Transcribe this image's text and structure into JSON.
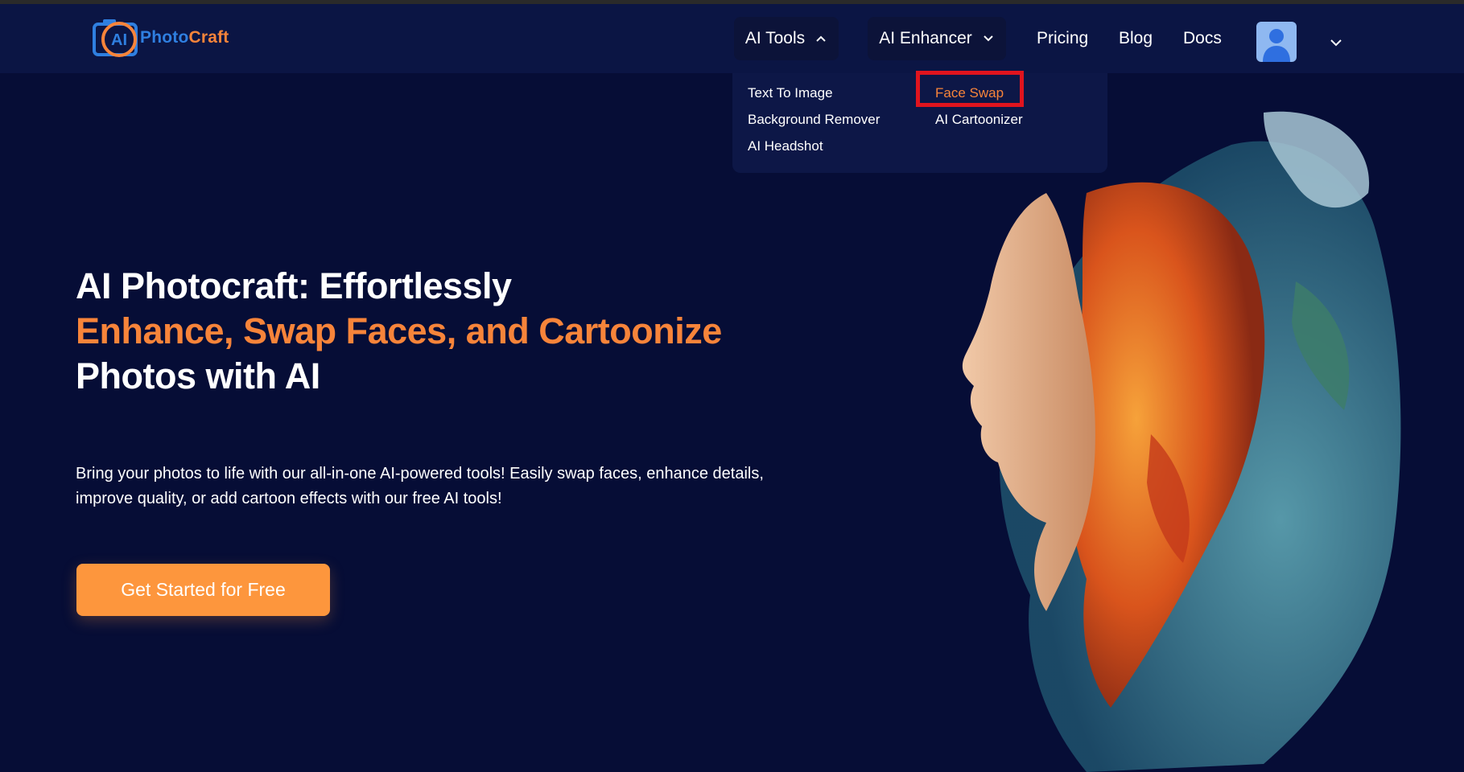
{
  "brand": {
    "name_part1": "Photo",
    "name_part2": "Craft",
    "mark_text": "AI"
  },
  "nav": {
    "ai_tools": "AI Tools",
    "ai_enhancer": "AI Enhancer",
    "pricing": "Pricing",
    "blog": "Blog",
    "docs": "Docs"
  },
  "dropdown": {
    "left_items": [
      "Text To Image",
      "Background Remover",
      "AI Headshot"
    ],
    "right_items": [
      "Face Swap",
      "AI Cartoonizer"
    ],
    "active_item": "Face Swap"
  },
  "hero": {
    "title_line1": "AI Photocraft: Effortlessly",
    "title_line2": "Enhance, Swap Faces, and Cartoonize",
    "title_line3": "Photos with AI",
    "subtitle": "Bring your photos to life with our all-in-one AI-powered tools! Easily swap faces, enhance details, improve quality, or add cartoon effects with our free AI tools!",
    "cta_label": "Get Started for Free"
  },
  "icons": {
    "logo": "camera-logo-icon",
    "ai_tools_chevron": "chevron-up-icon",
    "ai_enhancer_chevron": "chevron-down-icon",
    "avatar": "user-avatar-icon",
    "account_chevron": "chevron-down-icon"
  },
  "colors": {
    "background": "#060d36",
    "navbar": "#0b1544",
    "accent_orange": "#f7843a",
    "cta": "#fd963d",
    "logo_blue": "#2f7fe0",
    "highlight_red": "#e0141e"
  }
}
